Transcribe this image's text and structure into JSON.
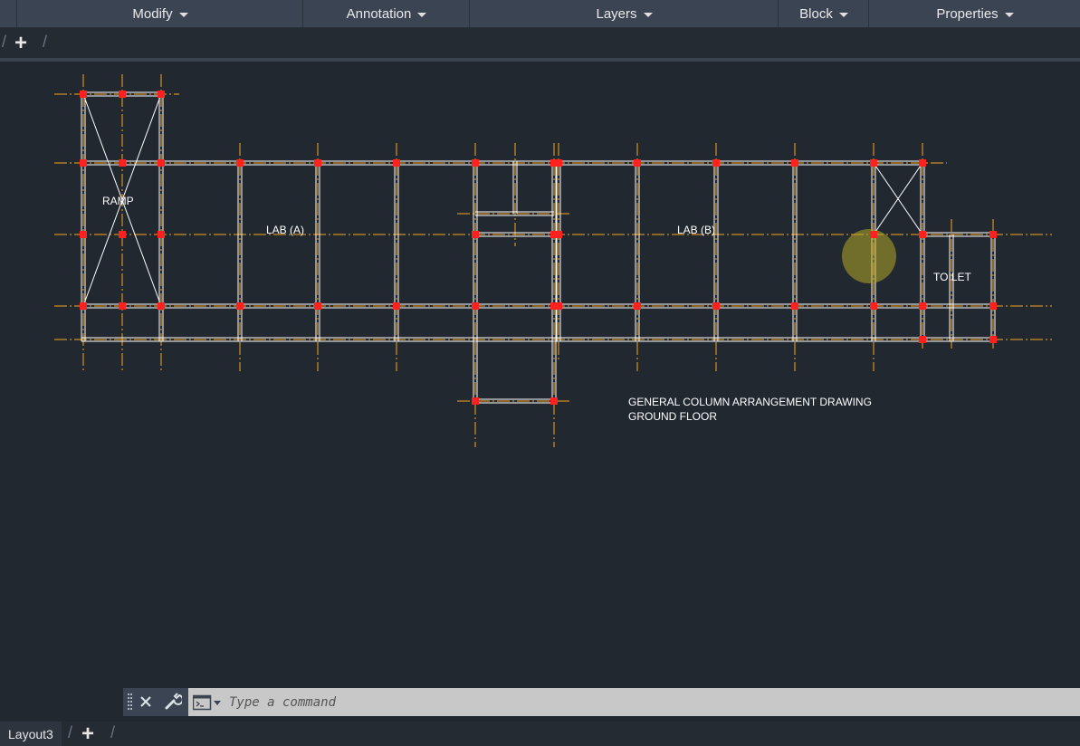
{
  "ribbon": {
    "panels": [
      {
        "label": "Modify"
      },
      {
        "label": "Annotation"
      },
      {
        "label": "Layers"
      },
      {
        "label": "Block"
      },
      {
        "label": "Properties"
      }
    ]
  },
  "drawing": {
    "labels": {
      "ramp": "RAMP",
      "lab_a": "LAB (A)",
      "lab_b": "LAB (B)",
      "toilet": "TOILET",
      "title_line1": "GENERAL COLUMN ARRANGEMENT DRAWING",
      "title_line2": "GROUND  FLOOR"
    },
    "colors": {
      "background": "#212830",
      "wall": "#ffffff",
      "gridline": "#f5a623",
      "column": "#ff2020",
      "cursor_highlight": "#b5a526"
    }
  },
  "command_line": {
    "placeholder": "Type a command",
    "icons": [
      "grip-icon",
      "close-icon",
      "wrench-icon",
      "terminal-icon",
      "dropdown-caret-icon"
    ]
  },
  "layout_tabs": {
    "items": [
      {
        "label": "Layout3"
      }
    ],
    "add_label": "+"
  }
}
